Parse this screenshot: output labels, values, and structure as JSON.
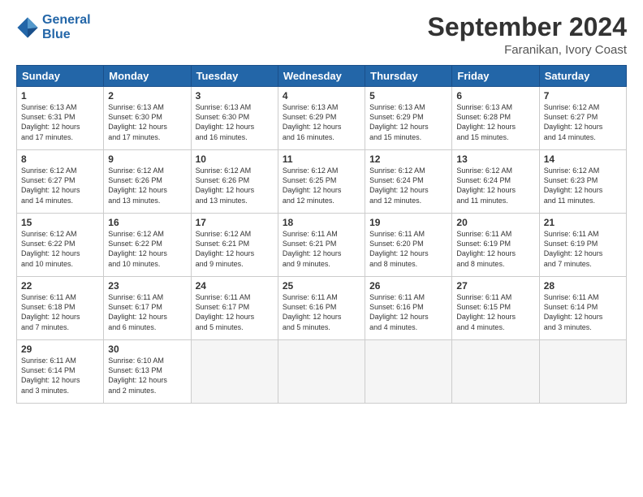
{
  "header": {
    "logo_line1": "General",
    "logo_line2": "Blue",
    "month_title": "September 2024",
    "location": "Faranikan, Ivory Coast"
  },
  "weekdays": [
    "Sunday",
    "Monday",
    "Tuesday",
    "Wednesday",
    "Thursday",
    "Friday",
    "Saturday"
  ],
  "weeks": [
    [
      {
        "day": "1",
        "info": "Sunrise: 6:13 AM\nSunset: 6:31 PM\nDaylight: 12 hours\nand 17 minutes."
      },
      {
        "day": "2",
        "info": "Sunrise: 6:13 AM\nSunset: 6:30 PM\nDaylight: 12 hours\nand 17 minutes."
      },
      {
        "day": "3",
        "info": "Sunrise: 6:13 AM\nSunset: 6:30 PM\nDaylight: 12 hours\nand 16 minutes."
      },
      {
        "day": "4",
        "info": "Sunrise: 6:13 AM\nSunset: 6:29 PM\nDaylight: 12 hours\nand 16 minutes."
      },
      {
        "day": "5",
        "info": "Sunrise: 6:13 AM\nSunset: 6:29 PM\nDaylight: 12 hours\nand 15 minutes."
      },
      {
        "day": "6",
        "info": "Sunrise: 6:13 AM\nSunset: 6:28 PM\nDaylight: 12 hours\nand 15 minutes."
      },
      {
        "day": "7",
        "info": "Sunrise: 6:12 AM\nSunset: 6:27 PM\nDaylight: 12 hours\nand 14 minutes."
      }
    ],
    [
      {
        "day": "8",
        "info": "Sunrise: 6:12 AM\nSunset: 6:27 PM\nDaylight: 12 hours\nand 14 minutes."
      },
      {
        "day": "9",
        "info": "Sunrise: 6:12 AM\nSunset: 6:26 PM\nDaylight: 12 hours\nand 13 minutes."
      },
      {
        "day": "10",
        "info": "Sunrise: 6:12 AM\nSunset: 6:26 PM\nDaylight: 12 hours\nand 13 minutes."
      },
      {
        "day": "11",
        "info": "Sunrise: 6:12 AM\nSunset: 6:25 PM\nDaylight: 12 hours\nand 12 minutes."
      },
      {
        "day": "12",
        "info": "Sunrise: 6:12 AM\nSunset: 6:24 PM\nDaylight: 12 hours\nand 12 minutes."
      },
      {
        "day": "13",
        "info": "Sunrise: 6:12 AM\nSunset: 6:24 PM\nDaylight: 12 hours\nand 11 minutes."
      },
      {
        "day": "14",
        "info": "Sunrise: 6:12 AM\nSunset: 6:23 PM\nDaylight: 12 hours\nand 11 minutes."
      }
    ],
    [
      {
        "day": "15",
        "info": "Sunrise: 6:12 AM\nSunset: 6:22 PM\nDaylight: 12 hours\nand 10 minutes."
      },
      {
        "day": "16",
        "info": "Sunrise: 6:12 AM\nSunset: 6:22 PM\nDaylight: 12 hours\nand 10 minutes."
      },
      {
        "day": "17",
        "info": "Sunrise: 6:12 AM\nSunset: 6:21 PM\nDaylight: 12 hours\nand 9 minutes."
      },
      {
        "day": "18",
        "info": "Sunrise: 6:11 AM\nSunset: 6:21 PM\nDaylight: 12 hours\nand 9 minutes."
      },
      {
        "day": "19",
        "info": "Sunrise: 6:11 AM\nSunset: 6:20 PM\nDaylight: 12 hours\nand 8 minutes."
      },
      {
        "day": "20",
        "info": "Sunrise: 6:11 AM\nSunset: 6:19 PM\nDaylight: 12 hours\nand 8 minutes."
      },
      {
        "day": "21",
        "info": "Sunrise: 6:11 AM\nSunset: 6:19 PM\nDaylight: 12 hours\nand 7 minutes."
      }
    ],
    [
      {
        "day": "22",
        "info": "Sunrise: 6:11 AM\nSunset: 6:18 PM\nDaylight: 12 hours\nand 7 minutes."
      },
      {
        "day": "23",
        "info": "Sunrise: 6:11 AM\nSunset: 6:17 PM\nDaylight: 12 hours\nand 6 minutes."
      },
      {
        "day": "24",
        "info": "Sunrise: 6:11 AM\nSunset: 6:17 PM\nDaylight: 12 hours\nand 5 minutes."
      },
      {
        "day": "25",
        "info": "Sunrise: 6:11 AM\nSunset: 6:16 PM\nDaylight: 12 hours\nand 5 minutes."
      },
      {
        "day": "26",
        "info": "Sunrise: 6:11 AM\nSunset: 6:16 PM\nDaylight: 12 hours\nand 4 minutes."
      },
      {
        "day": "27",
        "info": "Sunrise: 6:11 AM\nSunset: 6:15 PM\nDaylight: 12 hours\nand 4 minutes."
      },
      {
        "day": "28",
        "info": "Sunrise: 6:11 AM\nSunset: 6:14 PM\nDaylight: 12 hours\nand 3 minutes."
      }
    ],
    [
      {
        "day": "29",
        "info": "Sunrise: 6:11 AM\nSunset: 6:14 PM\nDaylight: 12 hours\nand 3 minutes."
      },
      {
        "day": "30",
        "info": "Sunrise: 6:10 AM\nSunset: 6:13 PM\nDaylight: 12 hours\nand 2 minutes."
      },
      {
        "day": "",
        "info": ""
      },
      {
        "day": "",
        "info": ""
      },
      {
        "day": "",
        "info": ""
      },
      {
        "day": "",
        "info": ""
      },
      {
        "day": "",
        "info": ""
      }
    ]
  ]
}
